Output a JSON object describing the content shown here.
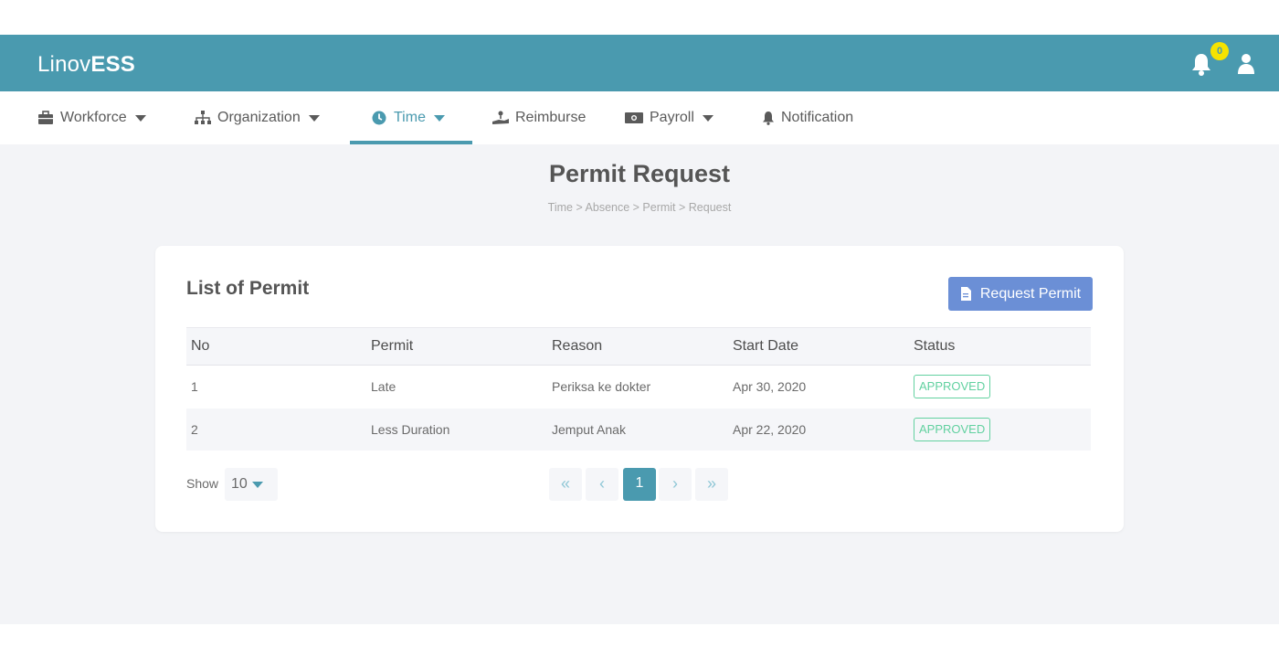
{
  "brand": {
    "light": "Linov",
    "bold": "ESS"
  },
  "header": {
    "notification_count": "0"
  },
  "nav": {
    "items": [
      {
        "label": "Workforce",
        "icon": "briefcase-icon",
        "dropdown": true
      },
      {
        "label": "Organization",
        "icon": "sitemap-icon",
        "dropdown": true
      },
      {
        "label": "Time",
        "icon": "clock-icon",
        "dropdown": true,
        "active": true
      },
      {
        "label": "Reimburse",
        "icon": "hand-coin-icon",
        "dropdown": false
      },
      {
        "label": "Payroll",
        "icon": "money-icon",
        "dropdown": true
      },
      {
        "label": "Notification",
        "icon": "bell-icon",
        "dropdown": false
      }
    ]
  },
  "page": {
    "title": "Permit Request",
    "breadcrumb": "Time > Absence > Permit > Request"
  },
  "card": {
    "title": "List of Permit",
    "request_button": "Request Permit"
  },
  "table": {
    "headers": [
      "No",
      "Permit",
      "Reason",
      "Start Date",
      "Status"
    ],
    "rows": [
      {
        "no": "1",
        "permit": "Late",
        "reason": "Periksa ke dokter",
        "start_date": "Apr 30, 2020",
        "status": "APPROVED"
      },
      {
        "no": "2",
        "permit": "Less Duration",
        "reason": "Jemput Anak",
        "start_date": "Apr 22, 2020",
        "status": "APPROVED"
      }
    ]
  },
  "footer": {
    "show_label": "Show",
    "page_size": "10",
    "pagination": {
      "first": "«",
      "prev": "‹",
      "current": "1",
      "next": "›",
      "last": "»"
    }
  },
  "colors": {
    "primary": "#4a9aaf",
    "button": "#6b8fd6",
    "approved": "#62d1a0",
    "badge": "#f5e300",
    "background": "#f3f4f7"
  }
}
